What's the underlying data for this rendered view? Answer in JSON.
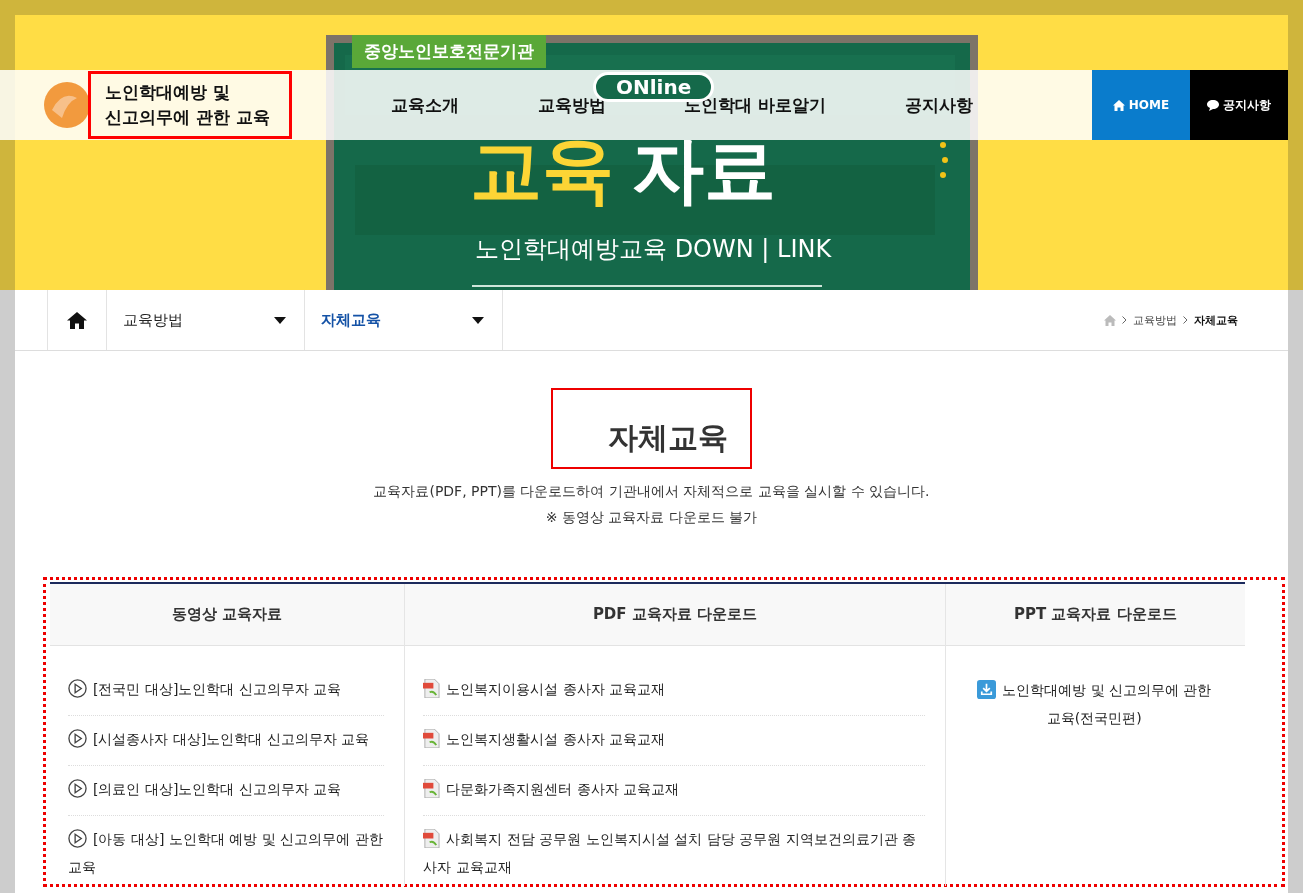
{
  "banner": {
    "kind": "picture",
    "badge": "중앙노인보호전문기관",
    "online": "ONline",
    "headline_yellow": "교육",
    "headline_white": "자료",
    "subline": "노인학대예방교육 DOWN | LINK"
  },
  "header": {
    "logo_title": "노인학대예방 및\n신고의무에 관한 교육",
    "nav": [
      {
        "label": "교육소개"
      },
      {
        "label": "교육방법"
      },
      {
        "label": "노인학대 바로알기"
      },
      {
        "label": "공지사항"
      }
    ],
    "quick": [
      {
        "kind": "home",
        "label": "HOME"
      },
      {
        "kind": "notice",
        "label": "공지사항"
      }
    ]
  },
  "subnav": {
    "dropdowns": [
      {
        "label": "교육방법",
        "selected": false
      },
      {
        "label": "자체교육",
        "selected": true
      }
    ],
    "breadcrumb": [
      {
        "label": "교육방법",
        "current": false
      },
      {
        "label": "자체교육",
        "current": true
      }
    ]
  },
  "page": {
    "title": "자체교육",
    "description": "교육자료(PDF, PPT)를 다운로드하여 기관내에서 자체적으로 교육을 실시할 수 있습니다.",
    "note": "※ 동영상 교육자료 다운로드 불가"
  },
  "columns": [
    {
      "kind": "video",
      "heading": "동영상 교육자료",
      "items": [
        "[전국민 대상]노인학대 신고의무자 교육",
        "[시설종사자 대상]노인학대 신고의무자 교육",
        "[의료인 대상]노인학대 신고의무자 교육",
        "[아동 대상] 노인학대 예방 및 신고의무에 관한 교육"
      ]
    },
    {
      "kind": "pdf",
      "heading": "PDF 교육자료 다운로드",
      "items": [
        "노인복지이용시설 종사자 교육교재",
        "노인복지생활시설 종사자 교육교재",
        "다문화가족지원센터 종사자 교육교재",
        "사회복지 전담 공무원 노인복지시설 설치 담당 공무원 지역보건의료기관 종사자 교육교재"
      ]
    },
    {
      "kind": "ppt",
      "heading": "PPT 교육자료 다운로드",
      "items": [
        "노인학대예방 및 신고의무에 관한 교육(전국민편)"
      ]
    }
  ]
}
